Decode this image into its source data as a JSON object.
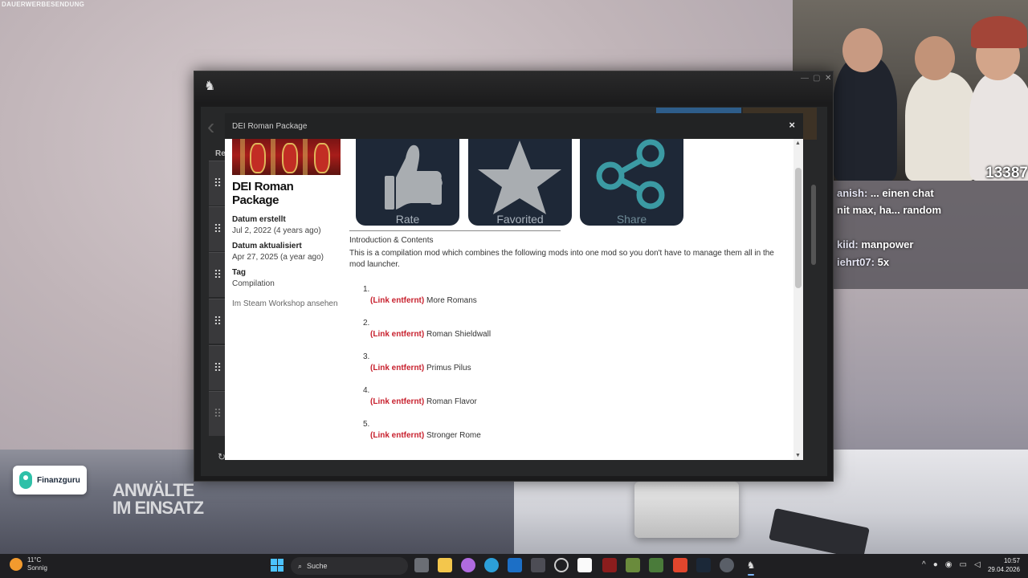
{
  "overlay": {
    "watermark": "DAUERWERBESENDUNG",
    "show_logo_line1": "ANWÄLTE",
    "show_logo_line2": "IM EINSATZ",
    "sponsor": "Finanzguru",
    "viewer_count": "13387"
  },
  "chat": [
    {
      "user": "anish:",
      "msg": "... einen chat"
    },
    {
      "user": "",
      "msg": "nit max, ha... random"
    },
    {
      "user": "kiid:",
      "msg": "manpower"
    },
    {
      "user": "iehrt07:",
      "msg": "5x"
    }
  ],
  "modal": {
    "title": "DEI Roman Package",
    "close": "×",
    "package_title": "DEI Roman Package",
    "created_label": "Datum erstellt",
    "created_value": "Jul 2, 2022 (4 years ago)",
    "updated_label": "Datum aktualisiert",
    "updated_value": "Apr 27, 2025 (a year ago)",
    "tag_label": "Tag",
    "tag_value": "Compilation",
    "steam_link": "Im Steam Workshop ansehen",
    "actions": {
      "rate": "Rate",
      "favorited": "Favorited",
      "share": "Share"
    },
    "intro_heading": "Introduction & Contents",
    "intro_text": "This is a compilation mod which combines the following mods into one mod so you don't have to manage them all in the mod launcher.",
    "link_removed": "(Link entfernt)",
    "mods": [
      {
        "num": "1.",
        "name": "More Romans"
      },
      {
        "num": "2.",
        "name": "Roman Shieldwall"
      },
      {
        "num": "3.",
        "name": "Primus Pilus"
      },
      {
        "num": "4.",
        "name": "Roman Flavor"
      },
      {
        "num": "5.",
        "name": "Stronger Rome"
      }
    ]
  },
  "app": {
    "header_partial": "Re"
  },
  "taskbar": {
    "temperature": "11°C",
    "weather": "Sonnig",
    "search_placeholder": "Suche",
    "time": "10:57",
    "date": "29.04.2026"
  }
}
